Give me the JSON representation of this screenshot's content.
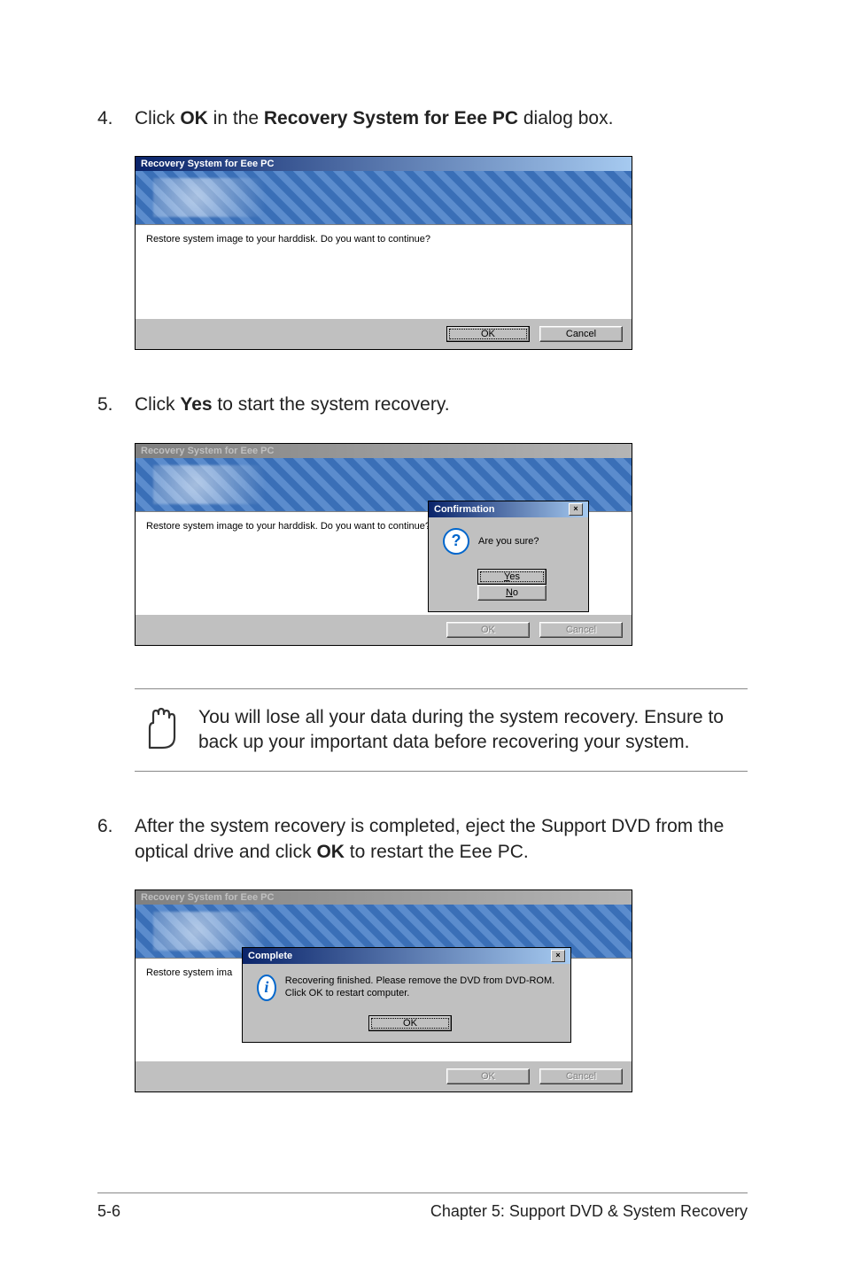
{
  "steps": {
    "s4": {
      "num": "4.",
      "pre": "Click ",
      "bold1": "OK",
      "mid": " in the ",
      "bold2": "Recovery System for Eee PC",
      "post": " dialog box."
    },
    "s5": {
      "num": "5.",
      "pre": "Click ",
      "bold1": "Yes",
      "post": " to start the system recovery."
    },
    "s6": {
      "num": "6.",
      "pre": "After the system recovery is completed, eject the Support DVD from the optical drive and click ",
      "bold1": "OK",
      "post": " to restart the Eee PC."
    }
  },
  "dlg1": {
    "title": "Recovery System for Eee PC",
    "body": "Restore system image to your harddisk. Do you want to continue?",
    "ok": "OK",
    "cancel": "Cancel"
  },
  "dlg2": {
    "title": "Recovery System for Eee PC",
    "body": "Restore system image to your harddisk. Do you want to continue?",
    "ok": "OK",
    "cancel": "Cancel",
    "confirm": {
      "title": "Confirmation",
      "msg": "Are you sure?",
      "yes_u": "Y",
      "yes_rest": "es",
      "no_u": "N",
      "no_rest": "o"
    }
  },
  "dlg3": {
    "title": "Recovery System for Eee PC",
    "body_short": "Restore system ima",
    "ok": "OK",
    "cancel": "Cancel",
    "complete": {
      "title": "Complete",
      "msg": "Recovering finished. Please remove the DVD from DVD-ROM. Click OK to restart computer.",
      "ok": "OK"
    }
  },
  "note": {
    "text": "You will lose all your data during the system recovery. Ensure to back up your important data before recovering your system."
  },
  "footer": {
    "left": "5-6",
    "right": "Chapter 5: Support DVD & System Recovery"
  }
}
